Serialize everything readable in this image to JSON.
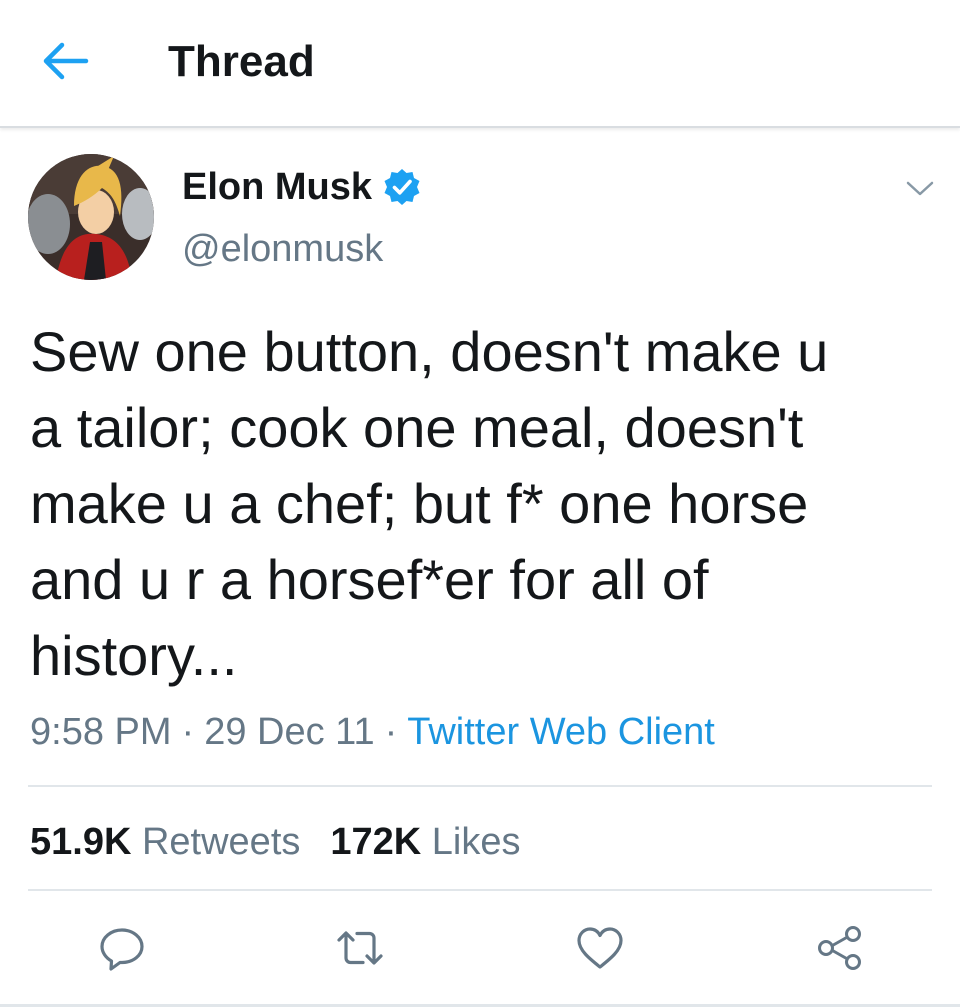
{
  "header": {
    "title": "Thread",
    "back_icon": "arrow-left-icon"
  },
  "tweet": {
    "author_name": "Elon Musk",
    "author_handle": "@elonmusk",
    "verified": true,
    "text": "Sew one button, doesn't make u\na tailor; cook one meal, doesn't\nmake u a chef; but f* one horse\nand u r a horsef*er for all of\nhistory...",
    "time": "9:58 PM",
    "date": "29 Dec 11",
    "separator": "·",
    "client": "Twitter Web Client"
  },
  "stats": {
    "retweets_count": "51.9K",
    "retweets_label": "Retweets",
    "likes_count": "172K",
    "likes_label": "Likes"
  },
  "actions": [
    "reply-icon",
    "retweet-icon",
    "like-icon",
    "share-icon"
  ],
  "colors": {
    "accent": "#1da1f2",
    "link": "#1b95e0",
    "secondary_text": "#657786",
    "divider": "#e1e6ea"
  }
}
